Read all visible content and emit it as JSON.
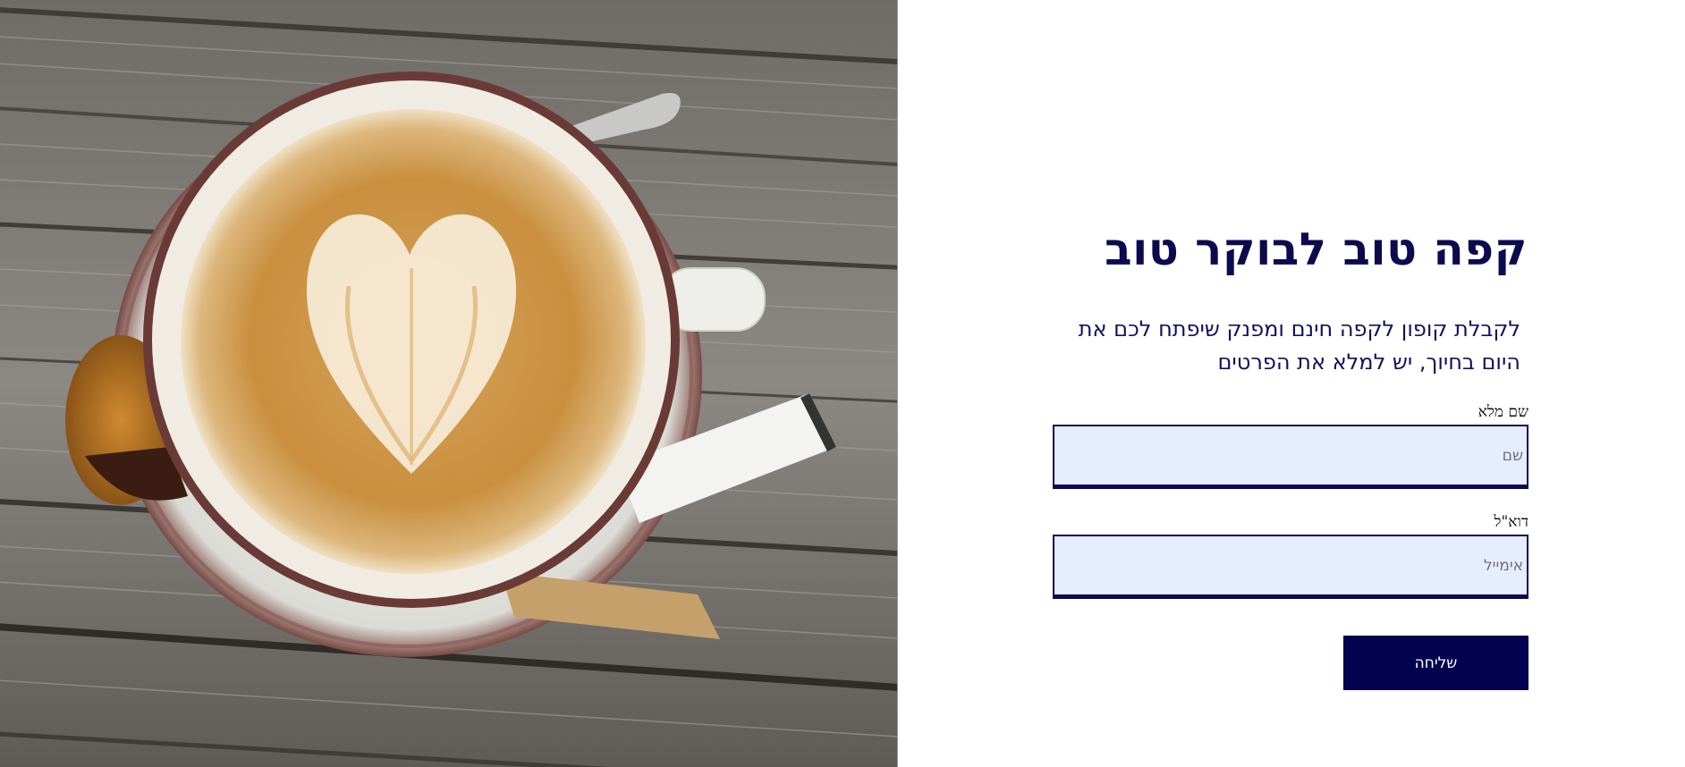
{
  "hero": {
    "image_alt": "cappuccino-latte-art-photo"
  },
  "form": {
    "title": "קפה טוב לבוקר טוב",
    "intro": "לקבלת קופון לקפה חינם ומפנק שיפתח לכם את היום בחיוך, יש למלא את הפרטים",
    "name": {
      "label": "שם מלא",
      "placeholder": "שם"
    },
    "email": {
      "label": "דוא\"ל",
      "placeholder": "אימייל"
    },
    "submit_label": "שליחה"
  },
  "colors": {
    "primary": "#02024f",
    "heading": "#0b0a4f",
    "input_bg": "#e6edff",
    "page_bg": "#ffffff"
  }
}
